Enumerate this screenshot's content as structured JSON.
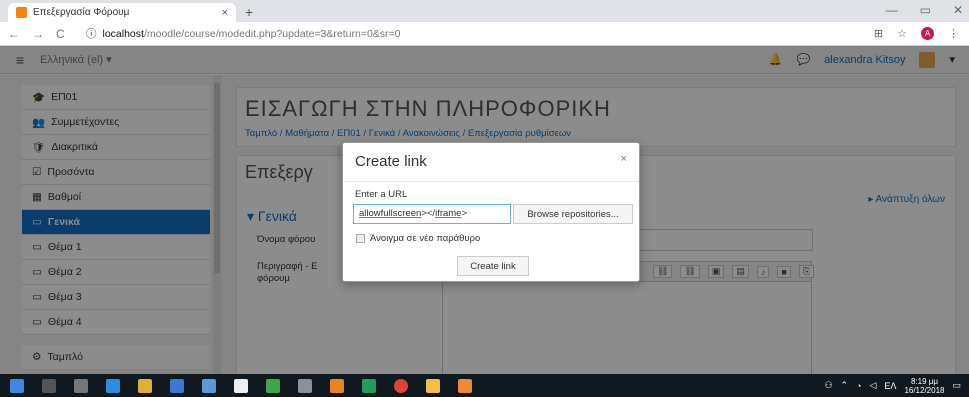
{
  "browser": {
    "tab_title": "Επεξεργασία Φόρουμ",
    "tab_close": "×",
    "new_tab": "+",
    "url_host": "localhost",
    "url_rest": "/moodle/course/modedit.php?update=3&return=0&sr=0",
    "back": "←",
    "forward": "→",
    "reload": "C",
    "info": "ⓘ",
    "profile_initial": "A",
    "win_min": "—",
    "win_max": "▭",
    "win_close": "✕"
  },
  "navbar": {
    "menu": "≡",
    "language": "Ελληνικά (el) ▾",
    "bell": "🔔",
    "chat": "💬",
    "user": "alexandra Kitsoy",
    "caret": "▾"
  },
  "drawer": {
    "items": [
      {
        "icon": "🎓",
        "label": "ΕΠ01"
      },
      {
        "icon": "👥",
        "label": "Συμμετέχοντες"
      },
      {
        "icon": "🛡",
        "label": "Διακριτικά"
      },
      {
        "icon": "☑",
        "label": "Προσόντα"
      },
      {
        "icon": "▦",
        "label": "Βαθμοί"
      },
      {
        "icon": "▭",
        "label": "Γενικά"
      },
      {
        "icon": "▭",
        "label": "Θέμα 1"
      },
      {
        "icon": "▭",
        "label": "Θέμα 2"
      },
      {
        "icon": "▭",
        "label": "Θέμα 3"
      },
      {
        "icon": "▭",
        "label": "Θέμα 4"
      },
      {
        "icon": "⚙",
        "label": "Ταμπλό"
      }
    ],
    "active_index": 5
  },
  "main": {
    "course_title": "ΕΙΣΑΓΩΓΗ ΣΤΗΝ ΠΛΗΡΟΦΟΡΙΚΗ",
    "breadcrumb": "Ταμπλό / Μαθήματα / ΕΠ01 / Γενικά / Ανακοινώσεις / Επεξεργασία ρυθμίσεων",
    "editing_title": "Επεξεργ",
    "expand_all": "▸ Ανάπτυξη όλων",
    "section": "▾ Γενικά",
    "field_name_label": "Όνομα φόρου",
    "field_desc_label": "Περιγραφή - Ε φόρουμ"
  },
  "modal": {
    "title": "Create link",
    "close": "×",
    "url_label": "Enter a URL",
    "url_value_a": "allowfullscreen",
    "url_value_b": "></",
    "url_value_c": "iframe",
    "url_value_d": ">",
    "browse_label": "Browse repositories...",
    "new_window_label": "Άνοιγμα σε νέο παράθυρο",
    "create_label": "Create link"
  },
  "taskbar": {
    "clock_time": "8:19 μμ",
    "clock_date": "16/12/2018",
    "lang": "ΕΛ"
  }
}
